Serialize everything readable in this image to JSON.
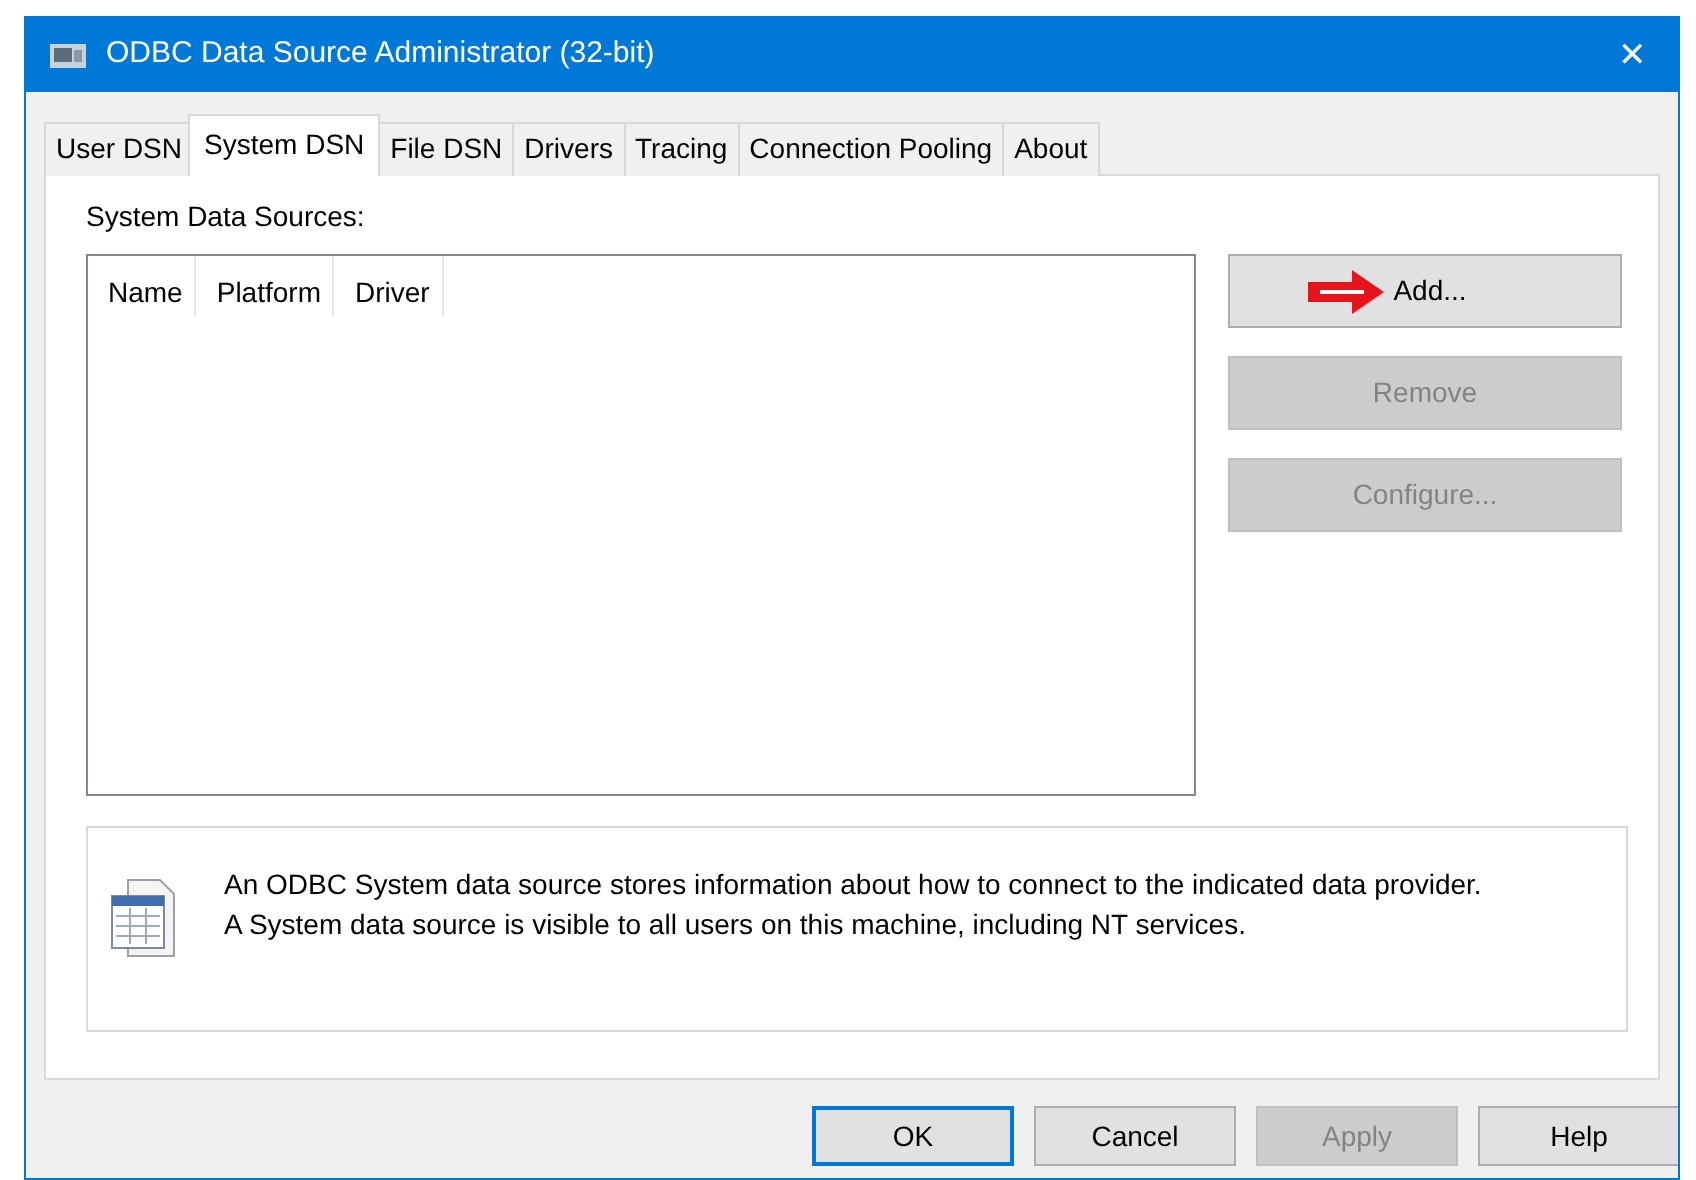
{
  "window": {
    "title": "ODBC Data Source Administrator (32-bit)",
    "close": "✕"
  },
  "tabs": [
    {
      "label": "User DSN",
      "selected": false
    },
    {
      "label": "System DSN",
      "selected": true
    },
    {
      "label": "File DSN",
      "selected": false
    },
    {
      "label": "Drivers",
      "selected": false
    },
    {
      "label": "Tracing",
      "selected": false
    },
    {
      "label": "Connection Pooling",
      "selected": false
    },
    {
      "label": "About",
      "selected": false
    }
  ],
  "list_label": "System Data Sources:",
  "list": {
    "columns": [
      "Name",
      "Platform",
      "Driver"
    ]
  },
  "side_buttons": [
    {
      "label": "Add...",
      "disabled": false,
      "annotated": true
    },
    {
      "label": "Remove",
      "disabled": true,
      "annotated": false
    },
    {
      "label": "Configure...",
      "disabled": true,
      "annotated": false
    }
  ],
  "info": {
    "lines": [
      "An ODBC System data source stores information about how to connect to the indicated data provider.",
      "A System data source is visible to all users on this machine, including NT services."
    ]
  },
  "buttons": [
    {
      "label": "OK",
      "disabled": false,
      "default": true
    },
    {
      "label": "Cancel",
      "disabled": false,
      "default": false
    },
    {
      "label": "Apply",
      "disabled": true,
      "default": false
    },
    {
      "label": "Help",
      "disabled": false,
      "default": false
    }
  ]
}
